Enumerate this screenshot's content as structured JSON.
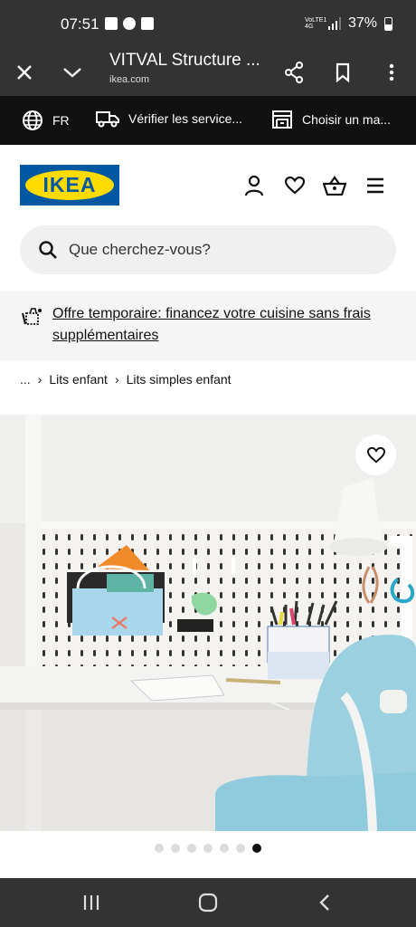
{
  "status_bar": {
    "time": "07:51",
    "network": "VoLTE1 4G",
    "battery": "37%"
  },
  "browser": {
    "title": "VITVAL Structure ...",
    "url": "ikea.com"
  },
  "topbar": {
    "language": "FR",
    "delivery": "Vérifier les service...",
    "store": "Choisir un ma..."
  },
  "header": {
    "logo_text": "IKEA"
  },
  "search": {
    "placeholder": "Que cherchez-vous?"
  },
  "offer": {
    "text": "Offre temporaire: financez votre cuisine sans frais supplémentaires"
  },
  "breadcrumb": {
    "ellipsis": "...",
    "separator": "›",
    "items": [
      "Lits enfant",
      "Lits simples enfant"
    ]
  },
  "gallery": {
    "total": 7,
    "active_index": 6
  },
  "colors": {
    "system_bar": "#333333",
    "topbar": "#111111",
    "ikea_blue": "#0058a3",
    "ikea_yellow": "#ffdb00"
  }
}
